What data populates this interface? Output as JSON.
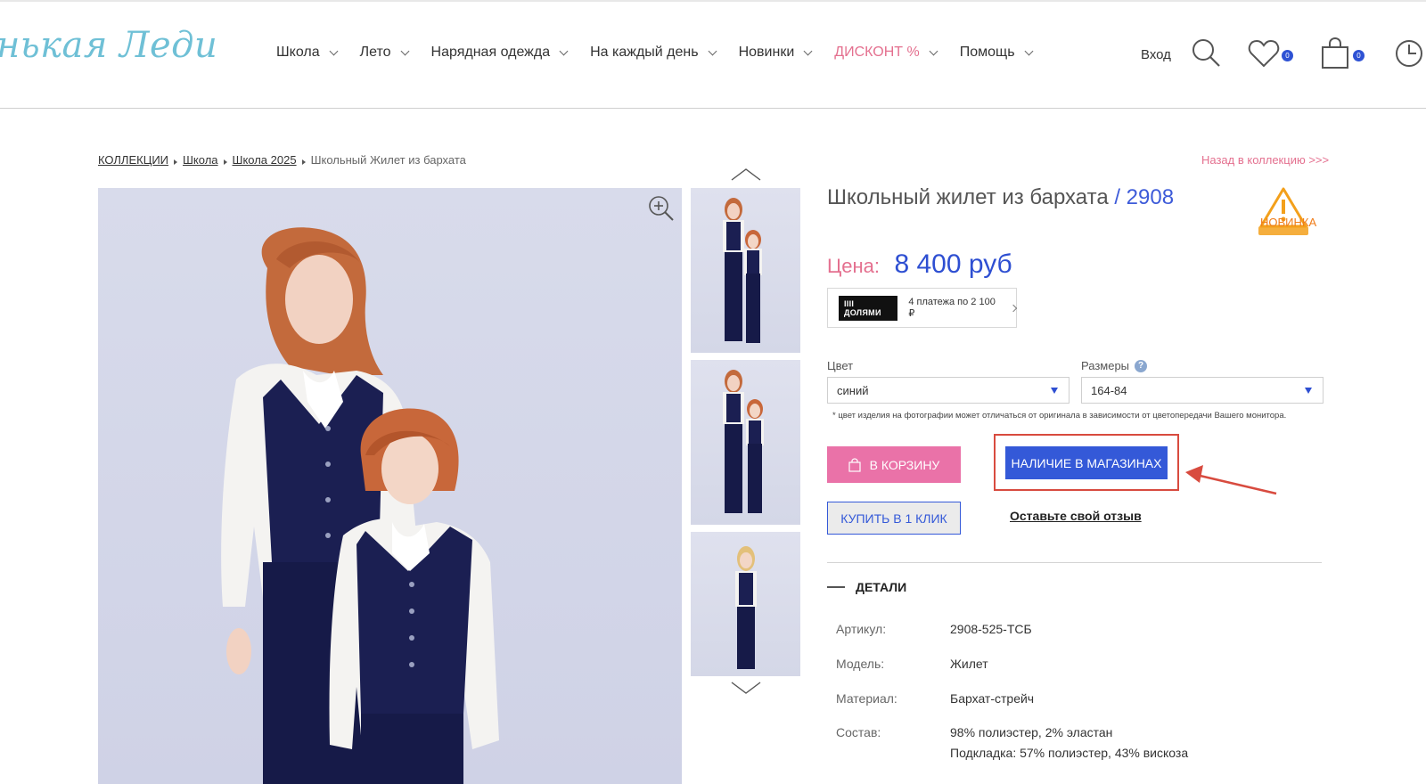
{
  "header": {
    "logo": "нькая Леди",
    "nav": [
      {
        "label": "Школа"
      },
      {
        "label": "Лето"
      },
      {
        "label": "Нарядная одежда"
      },
      {
        "label": "На каждый день"
      },
      {
        "label": "Новинки"
      },
      {
        "label": "ДИСКОНТ %"
      },
      {
        "label": "Помощь"
      }
    ],
    "login": "Вход",
    "wishlist_count": "0",
    "cart_count": "0",
    "accent_color": "#2e52d4",
    "discount_color": "#e4708f"
  },
  "breadcrumb": {
    "items": [
      "КОЛЛЕКЦИИ",
      "Школа",
      "Школа 2025"
    ],
    "current": "Школьный Жилет из бархата"
  },
  "back_link": "Назад в коллекцию >>>",
  "product": {
    "title": "Школьный жилет из бархата",
    "code": "/ 2908",
    "new_badge": "НОВИНКА",
    "price_label": "Цена:",
    "price_value": "8 400 руб",
    "dolyami_logo": "IIII ДОЛЯМИ",
    "dolyami_text": "4 платежа по 2 100 ₽",
    "color_label": "Цвет",
    "color_value": "синий",
    "size_label": "Размеры",
    "size_help": "?",
    "size_value": "164-84",
    "note": "* цвет изделия на фотографии может отличаться от оригинала в зависимости от цветопередачи Вашего монитора.",
    "cart_button": "В КОРЗИНУ",
    "stores_button": "НАЛИЧИЕ В МАГАЗИНАХ",
    "oneclick_button": "КУПИТЬ В 1 КЛИК",
    "review_link": "Оставьте свой отзыв",
    "details_heading": "ДЕТАЛИ",
    "specs": [
      {
        "label": "Артикул:",
        "value": "2908-525-ТСБ"
      },
      {
        "label": "Модель:",
        "value": "Жилет"
      },
      {
        "label": "Материал:",
        "value": "Бархат-стрейч"
      },
      {
        "label": "Состав:",
        "value": "98% полиэстер, 2% эластан",
        "value2": "Подкладка: 57% полиэстер, 43% вискоза"
      }
    ]
  }
}
